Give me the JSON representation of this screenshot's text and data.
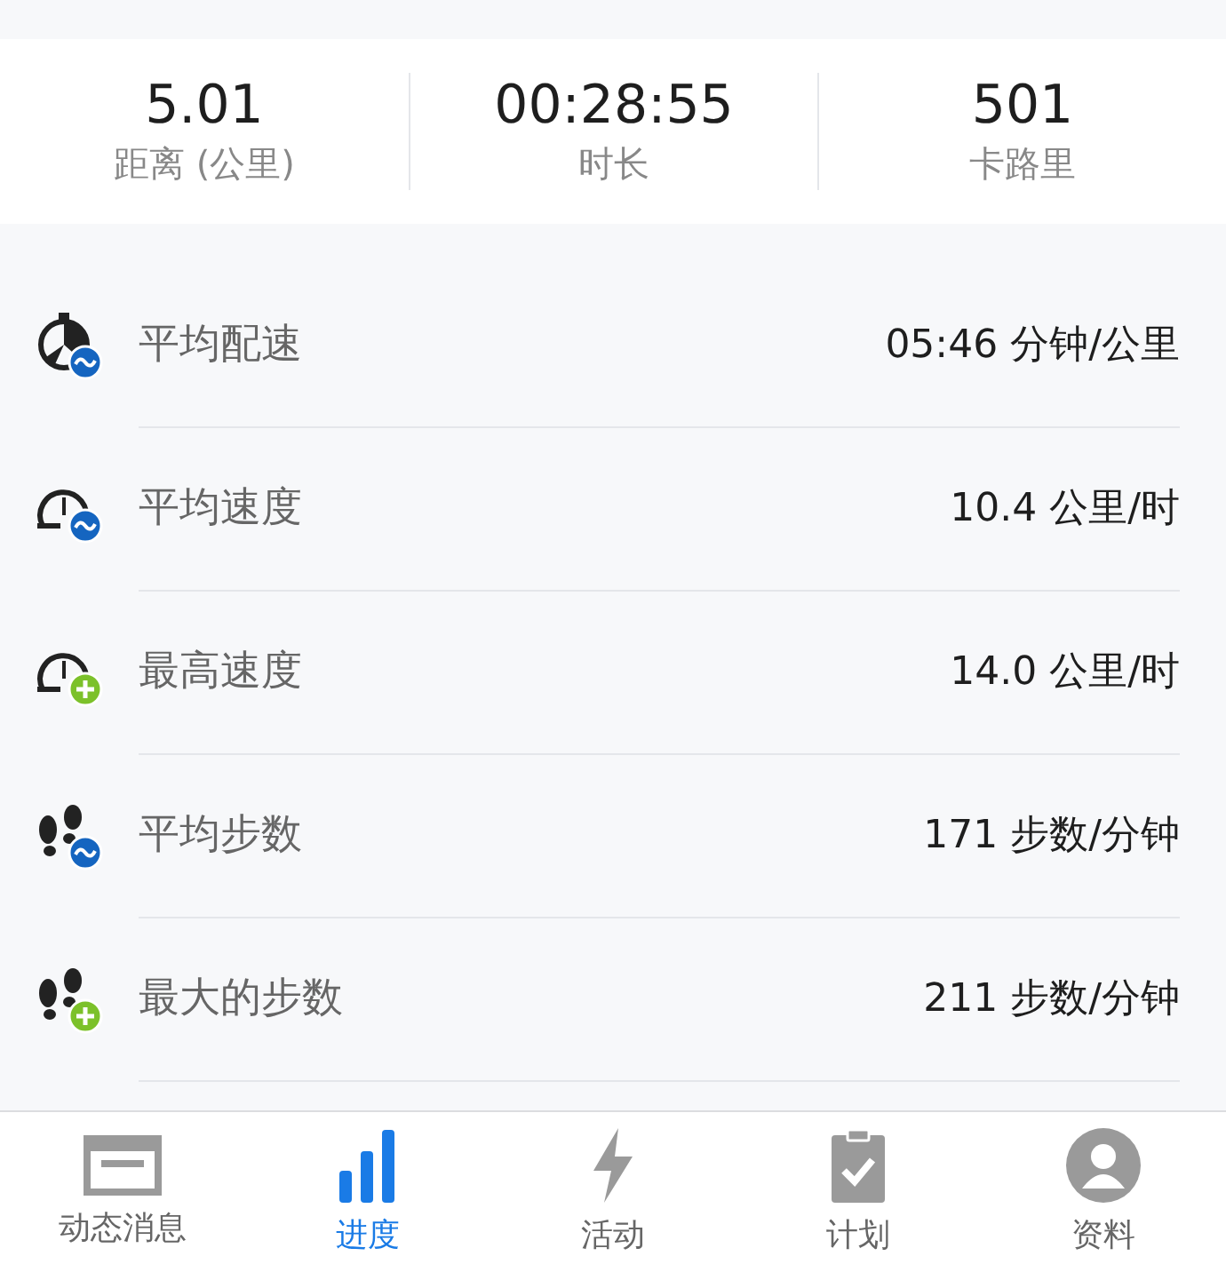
{
  "summary": [
    {
      "value": "5.01",
      "label": "距离 (公里)"
    },
    {
      "value": "00:28:55",
      "label": "时长"
    },
    {
      "value": "501",
      "label": "卡路里"
    }
  ],
  "metrics": [
    {
      "label": "平均配速",
      "value": "05:46 分钟/公里"
    },
    {
      "label": "平均速度",
      "value": "10.4 公里/时"
    },
    {
      "label": "最高速度",
      "value": "14.0 公里/时"
    },
    {
      "label": "平均步数",
      "value": "171 步数/分钟"
    },
    {
      "label": "最大的步数",
      "value": "211 步数/分钟"
    }
  ],
  "tabs": [
    {
      "label": "动态消息",
      "selected": false
    },
    {
      "label": "进度",
      "selected": true
    },
    {
      "label": "活动",
      "selected": false
    },
    {
      "label": "计划",
      "selected": false
    },
    {
      "label": "资料",
      "selected": false
    }
  ]
}
